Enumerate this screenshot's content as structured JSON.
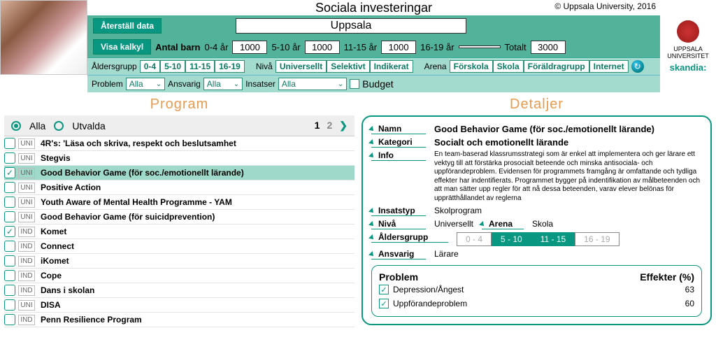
{
  "meta": {
    "title": "Sociala investeringar",
    "copyright": "© Uppsala University, 2016",
    "municipality": "Uppsala"
  },
  "buttons": {
    "reset": "Återställ data",
    "show_calc": "Visa kalkyl"
  },
  "age_counts": {
    "label": "Antal barn",
    "g0_4": {
      "label": "0-4 år",
      "value": "1000"
    },
    "g5_10": {
      "label": "5-10 år",
      "value": "1000"
    },
    "g11_15": {
      "label": "11-15 år",
      "value": "1000"
    },
    "g16_19": {
      "label": "16-19 år",
      "value": ""
    },
    "total": {
      "label": "Totalt",
      "value": "3000"
    }
  },
  "filters": {
    "age_group_label": "Åldersgrupp",
    "age_toggles": [
      "0-4",
      "5-10",
      "11-15",
      "16-19"
    ],
    "level_label": "Nivå",
    "level_toggles": [
      "Universellt",
      "Selektivt",
      "Indikerat"
    ],
    "arena_label": "Arena",
    "arena_toggles": [
      "Förskola",
      "Skola",
      "Föräldragrupp",
      "Internet"
    ],
    "problem_label": "Problem",
    "problem_value": "Alla",
    "responsible_label": "Ansvarig",
    "responsible_value": "Alla",
    "interventions_label": "Insatser",
    "interventions_value": "Alla",
    "budget_label": "Budget"
  },
  "logos": {
    "uu": "UPPSALA UNIVERSITET",
    "skandia": "skandia:"
  },
  "program": {
    "title": "Program",
    "filter_all": "Alla",
    "filter_selected": "Utvalda",
    "page1": "1",
    "page2": "2",
    "items": [
      {
        "level": "UNI",
        "name": "4R's: 'Läsa och skriva, respekt och beslutsamhet",
        "checked": false
      },
      {
        "level": "UNI",
        "name": "Stegvis",
        "checked": false
      },
      {
        "level": "UNI",
        "name": "Good Behavior Game (för soc./emotionellt lärande)",
        "checked": true,
        "highlight": true
      },
      {
        "level": "UNI",
        "name": "Positive Action",
        "checked": false
      },
      {
        "level": "UNI",
        "name": "Youth Aware of Mental Health Programme - YAM",
        "checked": false
      },
      {
        "level": "UNI",
        "name": "Good Behavior Game (för suicidprevention)",
        "checked": false
      },
      {
        "level": "IND",
        "name": "Komet",
        "checked": true
      },
      {
        "level": "IND",
        "name": "Connect",
        "checked": false
      },
      {
        "level": "IND",
        "name": "iKomet",
        "checked": false
      },
      {
        "level": "IND",
        "name": "Cope",
        "checked": false
      },
      {
        "level": "IND",
        "name": "Dans i skolan",
        "checked": false
      },
      {
        "level": "UNI",
        "name": "DISA",
        "checked": false
      },
      {
        "level": "IND",
        "name": "Penn Resilience Program",
        "checked": false
      }
    ]
  },
  "details": {
    "title": "Detaljer",
    "name_label": "Namn",
    "category_label": "Kategori",
    "info_label": "Info",
    "type_label": "Insatstyp",
    "level_label": "Nivå",
    "arena_label": "Arena",
    "agegroup_label": "Åldersgrupp",
    "responsible_label": "Ansvarig",
    "name": "Good Behavior Game (för soc./emotionellt lärande)",
    "category": "Socialt och emotionellt lärande",
    "info": "En team-baserad klassrumsstrategi som är enkel att implementera och ger lärare ett vektyg till att förstärka prosocialt beteende och minska antisociala- och uppförandeproblem. Evidensen för programmets framgång är omfattande och tydliga effekter har indentifierats. Programmet bygger på indentifikation av målbeteenden och att man sätter upp regler för att nå dessa beteenden, varav elever belönas för upprätthållandet av reglerna",
    "type": "Skolprogram",
    "level": "Universellt",
    "arena": "Skola",
    "responsible": "Lärare",
    "age_badges": [
      {
        "label": "0 - 4",
        "on": false
      },
      {
        "label": "5 - 10",
        "on": true
      },
      {
        "label": "11 - 15",
        "on": true
      },
      {
        "label": "16 - 19",
        "on": false
      }
    ],
    "problems": {
      "header": "Problem",
      "effects": "Effekter (%)",
      "rows": [
        {
          "name": "Depression/Ångest",
          "effect": "63"
        },
        {
          "name": "Uppförandeproblem",
          "effect": "60"
        }
      ]
    }
  }
}
